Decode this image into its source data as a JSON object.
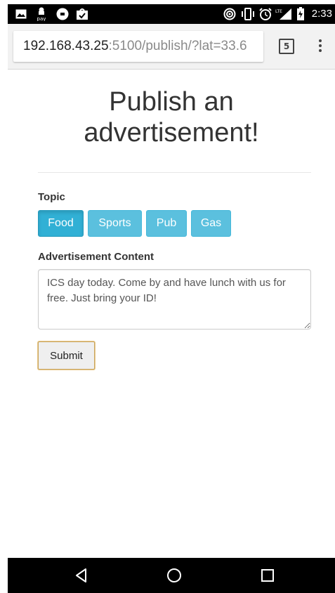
{
  "status_bar": {
    "time": "2:33",
    "left_icons": [
      "image-icon",
      "android-pay-icon",
      "uber-icon",
      "shopping-bag-icon"
    ],
    "right_icons": [
      "hotspot-icon",
      "vibrate-icon",
      "alarm-icon",
      "lte-signal-icon",
      "battery-icon"
    ],
    "network_label": "LTE"
  },
  "browser": {
    "url_host": "192.168.43.25",
    "url_rest": ":5100/publish/?lat=33.6",
    "tab_count": "5"
  },
  "page": {
    "title_line1": "Publish an",
    "title_line2": "advertisement!",
    "topic_label": "Topic",
    "topics": [
      {
        "label": "Food",
        "active": true
      },
      {
        "label": "Sports",
        "active": false
      },
      {
        "label": "Pub",
        "active": false
      },
      {
        "label": "Gas",
        "active": false
      }
    ],
    "content_label": "Advertisement Content",
    "content_value": "ICS day today. Come by and have lunch with us for free. Just bring your ID!",
    "submit_label": "Submit"
  },
  "colors": {
    "topic_button": "#5bc0de",
    "topic_button_active": "#31b0d5",
    "nav_bar": "#000000"
  }
}
